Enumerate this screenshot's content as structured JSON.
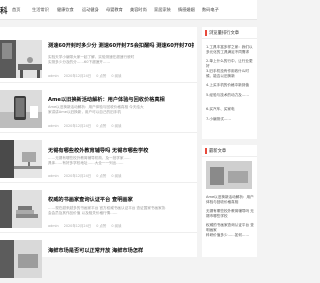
{
  "site": {
    "logo": "科"
  },
  "nav": [
    "首页",
    "生活常识",
    "健康饮食",
    "运动健身",
    "母婴教育",
    "美容时尚",
    "家居家装",
    "情感婚姻",
    "数码电子"
  ],
  "articles": [
    {
      "title": "测速60开封时多少分 测速60开封75会扣醒吗 测速60开封70扣多少分",
      "excerpt": [
        "实验天学小编带大家一起了解，实验测速在超速行驶时",
        "实测多少分及的分……60下超速开……"
      ],
      "meta": [
        "admin",
        "2020年12月24日",
        "0 点赞",
        "0 阅读"
      ]
    },
    {
      "title": "Ame以旧换新活动解析：用户体验与回收价格真相",
      "excerpt": [
        "Ame以旧换新活动解析：用户体验与回收价格真相 今天给大",
        "家讲讲Ame以旧换新，用户可以自己的旧手机"
      ],
      "meta": [
        "admin",
        "2020年12月24日",
        "0 点赞",
        "0 阅读"
      ]
    },
    {
      "title": "无锡有哪些校外教育辅导吗 无锡市哪些学校",
      "excerpt": [
        "……无锡有哪些校外教育辅导机构，及一批学家……",
        "具体……有好多学校地址……大全一一列出……"
      ],
      "meta": [
        "admin",
        "2020年12月24日",
        "0 点赞",
        "0 阅读"
      ]
    },
    {
      "title": "权威的书画家查询认证平台 查明画家",
      "excerpt": [
        "……现在越来越多的书画家平台 官方权威书画认证平台 查证国家书画家协",
        "会会员及其作品价值 以及相关价格行情……"
      ],
      "meta": [
        "admin",
        "2020年12月24日",
        "0 点赞",
        "0 阅读"
      ]
    },
    {
      "title": "海鲜市场是否可以正常开放 海鲜市场怎样",
      "excerpt": [],
      "meta": []
    }
  ],
  "sidebar": {
    "box1": {
      "title": "浏览量排行文章",
      "items": [
        "1.工具丰富多样之家：我们以多元化的工具满足不同需求",
        "2.单上什么的行中，让行业更好",
        "3.旧手机没有作用收什么时候、能否以旧换新",
        "4.上买手机的价格中新到值",
        "5.经验与技术的动力及……",
        "6.买汽车、买家电",
        "7.小编测试……"
      ]
    },
    "box2": {
      "title": "最新文章",
      "items": [
        "Ame以旧换新活动解析：用户体验与回收价格真相",
        "无锡有哪些校外教育辅导吗 无锡市哪些学校",
        "权威的书画家查询认证平台 查明画家",
        "科研价值多少……如何……"
      ]
    }
  }
}
